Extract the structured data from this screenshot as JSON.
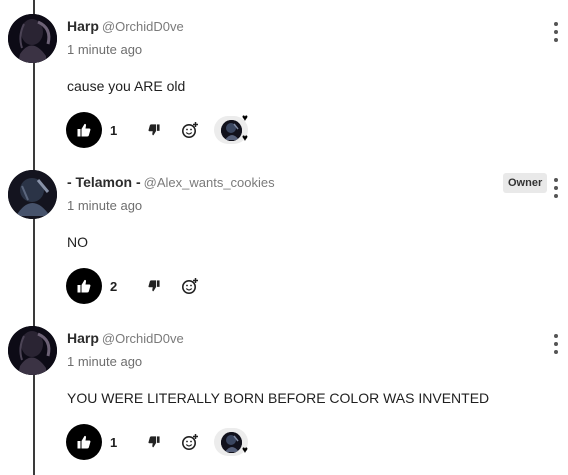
{
  "comments": [
    {
      "author": "Harp",
      "handle": "@OrchidD0ve",
      "time": "1 minute ago",
      "text": "cause you ARE old",
      "likes": "1",
      "badge": ""
    },
    {
      "author": "- Telamon -",
      "handle": "@Alex_wants_cookies",
      "time": "1 minute ago",
      "text": "NO",
      "likes": "2",
      "badge": "Owner"
    },
    {
      "author": "Harp",
      "handle": "@OrchidD0ve",
      "time": "1 minute ago",
      "text": "YOU WERE LITERALLY BORN BEFORE COLOR WAS INVENTED",
      "likes": "1",
      "badge": ""
    }
  ],
  "icons": {
    "like": "thumbs-up-icon",
    "dislike": "thumbs-down-icon",
    "react": "add-reaction-icon",
    "more": "more-vertical-icon",
    "heart": "heart-icon"
  },
  "colors": {
    "like_button_bg": "#000000",
    "thread_line": "#3a3a3a",
    "badge_bg": "#e9e9e9"
  }
}
